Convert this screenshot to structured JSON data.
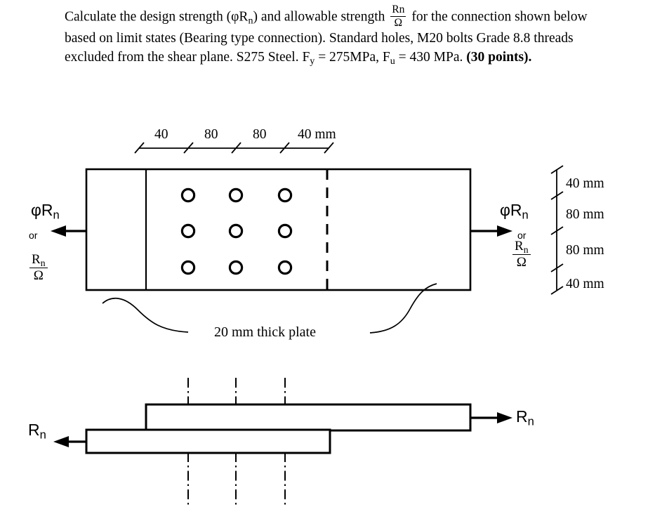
{
  "problem": {
    "line1_a": "Calculate the design strength (φR",
    "line1_a_sub": "n",
    "line1_b": ") and allowable strength ",
    "fraction_num": "Rn",
    "fraction_den": "Ω",
    "line1_c": " for the connection",
    "line2": "shown below based on limit states (Bearing type connection). Standard holes, M20",
    "line3_a": "bolts Grade 8.8 threads excluded from the shear plane. S275 Steel. F",
    "line3_a_sub": "y",
    "line3_b": " = 275MPa, F",
    "line3_b_sub": "u",
    "line3_c": " =",
    "line4_a": "430 MPa. ",
    "line4_bold": "(30 points)."
  },
  "figure": {
    "top_dimensions": [
      "40",
      "80",
      "80",
      "40 mm"
    ],
    "right_dimensions": [
      "40 mm",
      "80 mm",
      "80 mm",
      "40 mm"
    ],
    "thickness_note": "20 mm thick plate",
    "left_force": {
      "phi": "φR",
      "phi_sub": "n",
      "or": "or",
      "frac_num": "R",
      "frac_num_sub": "n",
      "frac_den": "Ω"
    },
    "right_force": {
      "phi": "φR",
      "phi_sub": "n",
      "or": "or",
      "frac_num": "R",
      "frac_num_sub": "n",
      "frac_den": "Ω"
    },
    "bolt_grid": {
      "rows": 3,
      "cols": 3,
      "count": 9
    }
  },
  "side_view": {
    "left_force": "R",
    "left_force_sub": "n",
    "right_force": "R",
    "right_force_sub": "n"
  },
  "colors": {
    "ink": "#000000",
    "background": "#ffffff"
  }
}
